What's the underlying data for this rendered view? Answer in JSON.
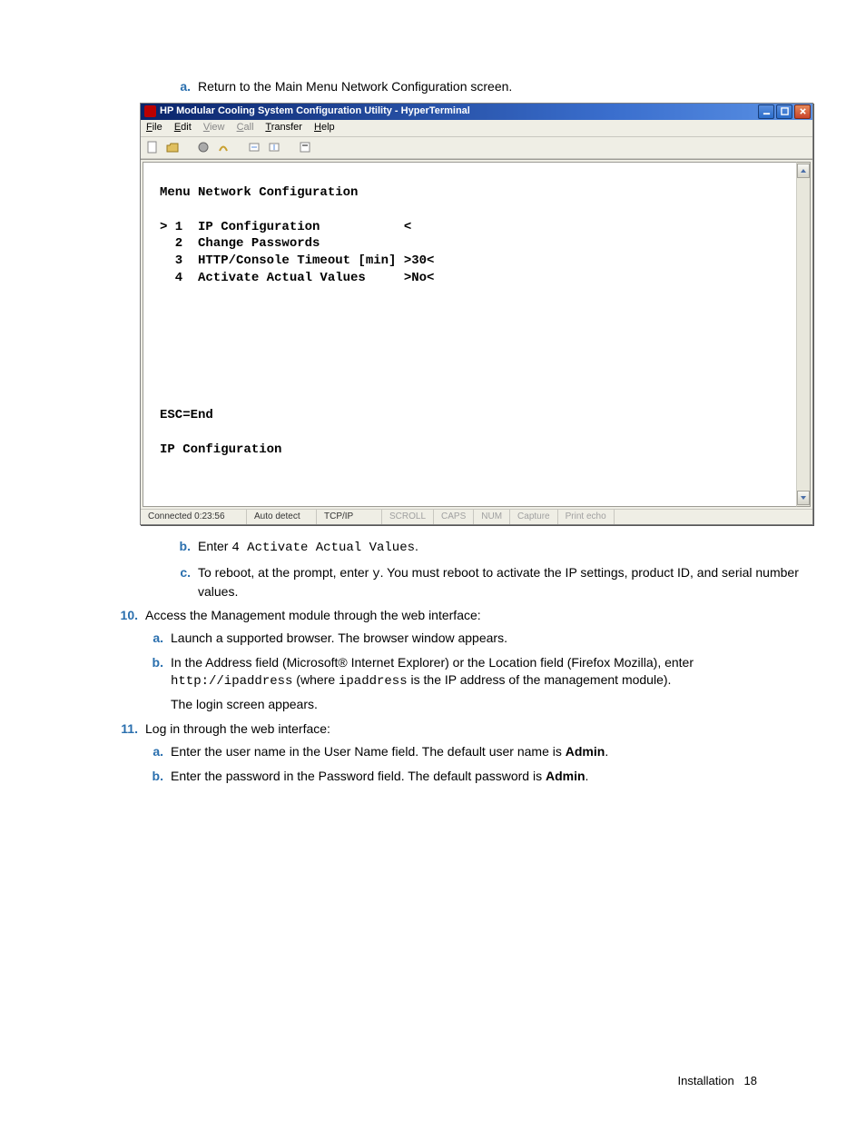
{
  "step_a_text": "Return to the Main Menu Network Configuration screen.",
  "ht": {
    "title": "HP Modular Cooling System Configuration Utility - HyperTerminal",
    "menus": {
      "file": "File",
      "edit": "Edit",
      "view": "View",
      "call": "Call",
      "transfer": "Transfer",
      "help": "Help"
    },
    "terminal": {
      "heading": "Menu Network Configuration",
      "rows": [
        {
          "cursor": "> ",
          "num": "1",
          "label": "IP Configuration",
          "val": "<"
        },
        {
          "cursor": "  ",
          "num": "2",
          "label": "Change Passwords",
          "val": ""
        },
        {
          "cursor": "  ",
          "num": "3",
          "label": "HTTP/Console Timeout [min]",
          "val": ">30<"
        },
        {
          "cursor": "  ",
          "num": "4",
          "label": "Activate Actual Values",
          "val": ">No<"
        }
      ],
      "esc": "ESC=End",
      "footer_line": "IP Configuration"
    },
    "status": {
      "conn": "Connected 0:23:56",
      "detect": "Auto detect",
      "proto": "TCP/IP",
      "scroll": "SCROLL",
      "caps": "CAPS",
      "num": "NUM",
      "cap": "Capture",
      "echo": "Print echo"
    }
  },
  "step_b": {
    "pre": "Enter ",
    "code": "4 Activate Actual Values",
    "post": "."
  },
  "step_c": {
    "pre": "To reboot, at the prompt, enter ",
    "code": "y",
    "post": ". You must reboot to activate the IP settings, product ID, and serial number values."
  },
  "item10": {
    "text": "Access the Management module through the web interface:",
    "a": "Launch a supported browser. The browser window appears.",
    "b_pre": "In the Address field (Microsoft® Internet Explorer) or the Location field (Firefox Mozilla), enter ",
    "b_code1": "http://ipaddress",
    "b_mid": " (where ",
    "b_code2": "ipaddress",
    "b_post": " is the IP address of the management module).",
    "b_line2": "The login screen appears."
  },
  "item11": {
    "text": "Log in through the web interface:",
    "a_pre": "Enter the user name in the User Name field. The default user name is ",
    "a_bold": "Admin",
    "a_post": ".",
    "b_pre": "Enter the password in the Password field. The default password is ",
    "b_bold": "Admin",
    "b_post": "."
  },
  "markers": {
    "a": "a.",
    "b": "b.",
    "c": "c.",
    "n10": "10.",
    "n11": "11."
  },
  "footer_label": "Installation",
  "footer_page": "18"
}
